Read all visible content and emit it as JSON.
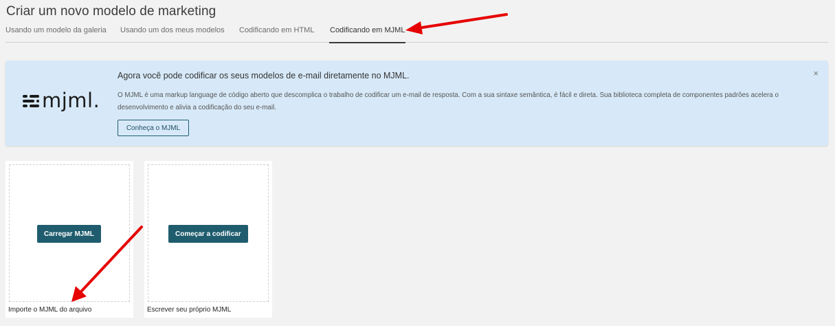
{
  "page": {
    "title": "Criar um novo modelo de marketing"
  },
  "tabs": [
    {
      "label": "Usando um modelo da galeria",
      "active": false
    },
    {
      "label": "Usando um dos meus modelos",
      "active": false
    },
    {
      "label": "Codificando em HTML",
      "active": false
    },
    {
      "label": "Codificando em MJML",
      "active": true
    }
  ],
  "banner": {
    "logo_text": "mjml.",
    "title": "Agora você pode codificar os seus modelos de e-mail diretamente no MJML.",
    "description": "O MJML é uma markup language de código aberto que descomplica o trabalho de codificar um e-mail de resposta. Com a sua sintaxe semântica, é fácil e direta. Sua biblioteca completa de componentes padrões acelera o desenvolvimento e alivia a codificação do seu e-mail.",
    "learn_button": "Conheça o MJML",
    "close_symbol": "×",
    "background_color": "#d7e9f8"
  },
  "cards": [
    {
      "button": "Carregar MJML",
      "label": "Importe o MJML do arquivo"
    },
    {
      "button": "Começar a codificar",
      "label": "Escrever seu próprio MJML"
    }
  ],
  "colors": {
    "accent": "#1f5d6e",
    "annotation": "#e60000"
  }
}
